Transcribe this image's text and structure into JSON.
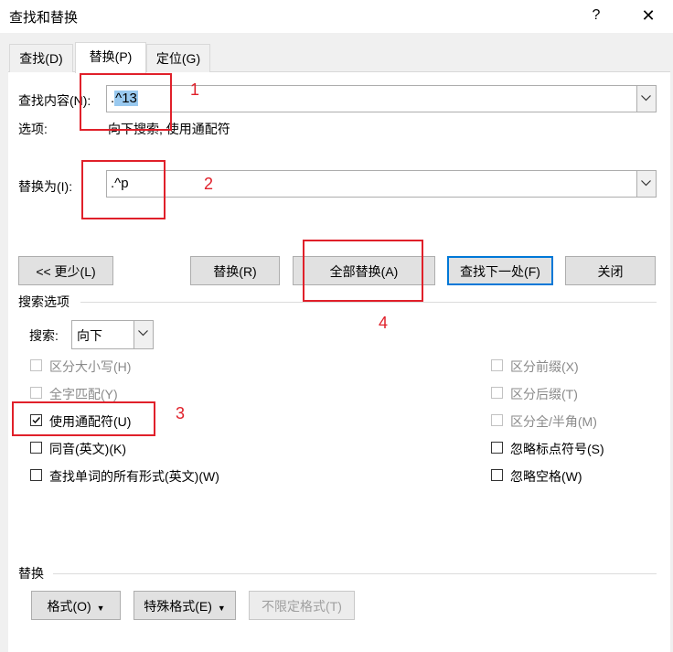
{
  "window": {
    "title": "查找和替换",
    "help": "?",
    "close": "✕"
  },
  "tabs": [
    {
      "label": "查找(D)"
    },
    {
      "label": "替换(P)"
    },
    {
      "label": "定位(G)"
    }
  ],
  "find": {
    "label": "查找内容(N):",
    "value_pre": ".",
    "value_sel": "^13",
    "options_label": "选项:",
    "options_value": "向下搜索, 使用通配符"
  },
  "replace": {
    "label": "替换为(I):",
    "value": ".^p"
  },
  "buttons": {
    "less": "<< 更少(L)",
    "replace": "替换(R)",
    "replace_all": "全部替换(A)",
    "find_next": "查找下一处(F)",
    "close": "关闭"
  },
  "search_options": {
    "header": "搜索选项",
    "direction_label": "搜索:",
    "direction_value": "向下"
  },
  "checkboxes": {
    "match_case": {
      "label": "区分大小写(H)",
      "checked": false,
      "enabled": false
    },
    "whole_word": {
      "label": "全字匹配(Y)",
      "checked": false,
      "enabled": false
    },
    "wildcards": {
      "label": "使用通配符(U)",
      "checked": true,
      "enabled": true
    },
    "sounds_like": {
      "label": "同音(英文)(K)",
      "checked": false,
      "enabled": true
    },
    "all_forms": {
      "label": "查找单词的所有形式(英文)(W)",
      "checked": false,
      "enabled": true
    },
    "prefix": {
      "label": "区分前缀(X)",
      "checked": false,
      "enabled": false
    },
    "suffix": {
      "label": "区分后缀(T)",
      "checked": false,
      "enabled": false
    },
    "full_half": {
      "label": "区分全/半角(M)",
      "checked": false,
      "enabled": false
    },
    "ignore_punct": {
      "label": "忽略标点符号(S)",
      "checked": false,
      "enabled": true
    },
    "ignore_space": {
      "label": "忽略空格(W)",
      "checked": false,
      "enabled": true
    }
  },
  "replace_section": {
    "header": "替换",
    "format": "格式(O)",
    "special": "特殊格式(E)",
    "no_format": "不限定格式(T)"
  },
  "annotations": [
    "1",
    "2",
    "3",
    "4"
  ],
  "colors": {
    "annotation": "#e0202a",
    "selection": "#99c9ef",
    "default_button": "#0078d7"
  }
}
